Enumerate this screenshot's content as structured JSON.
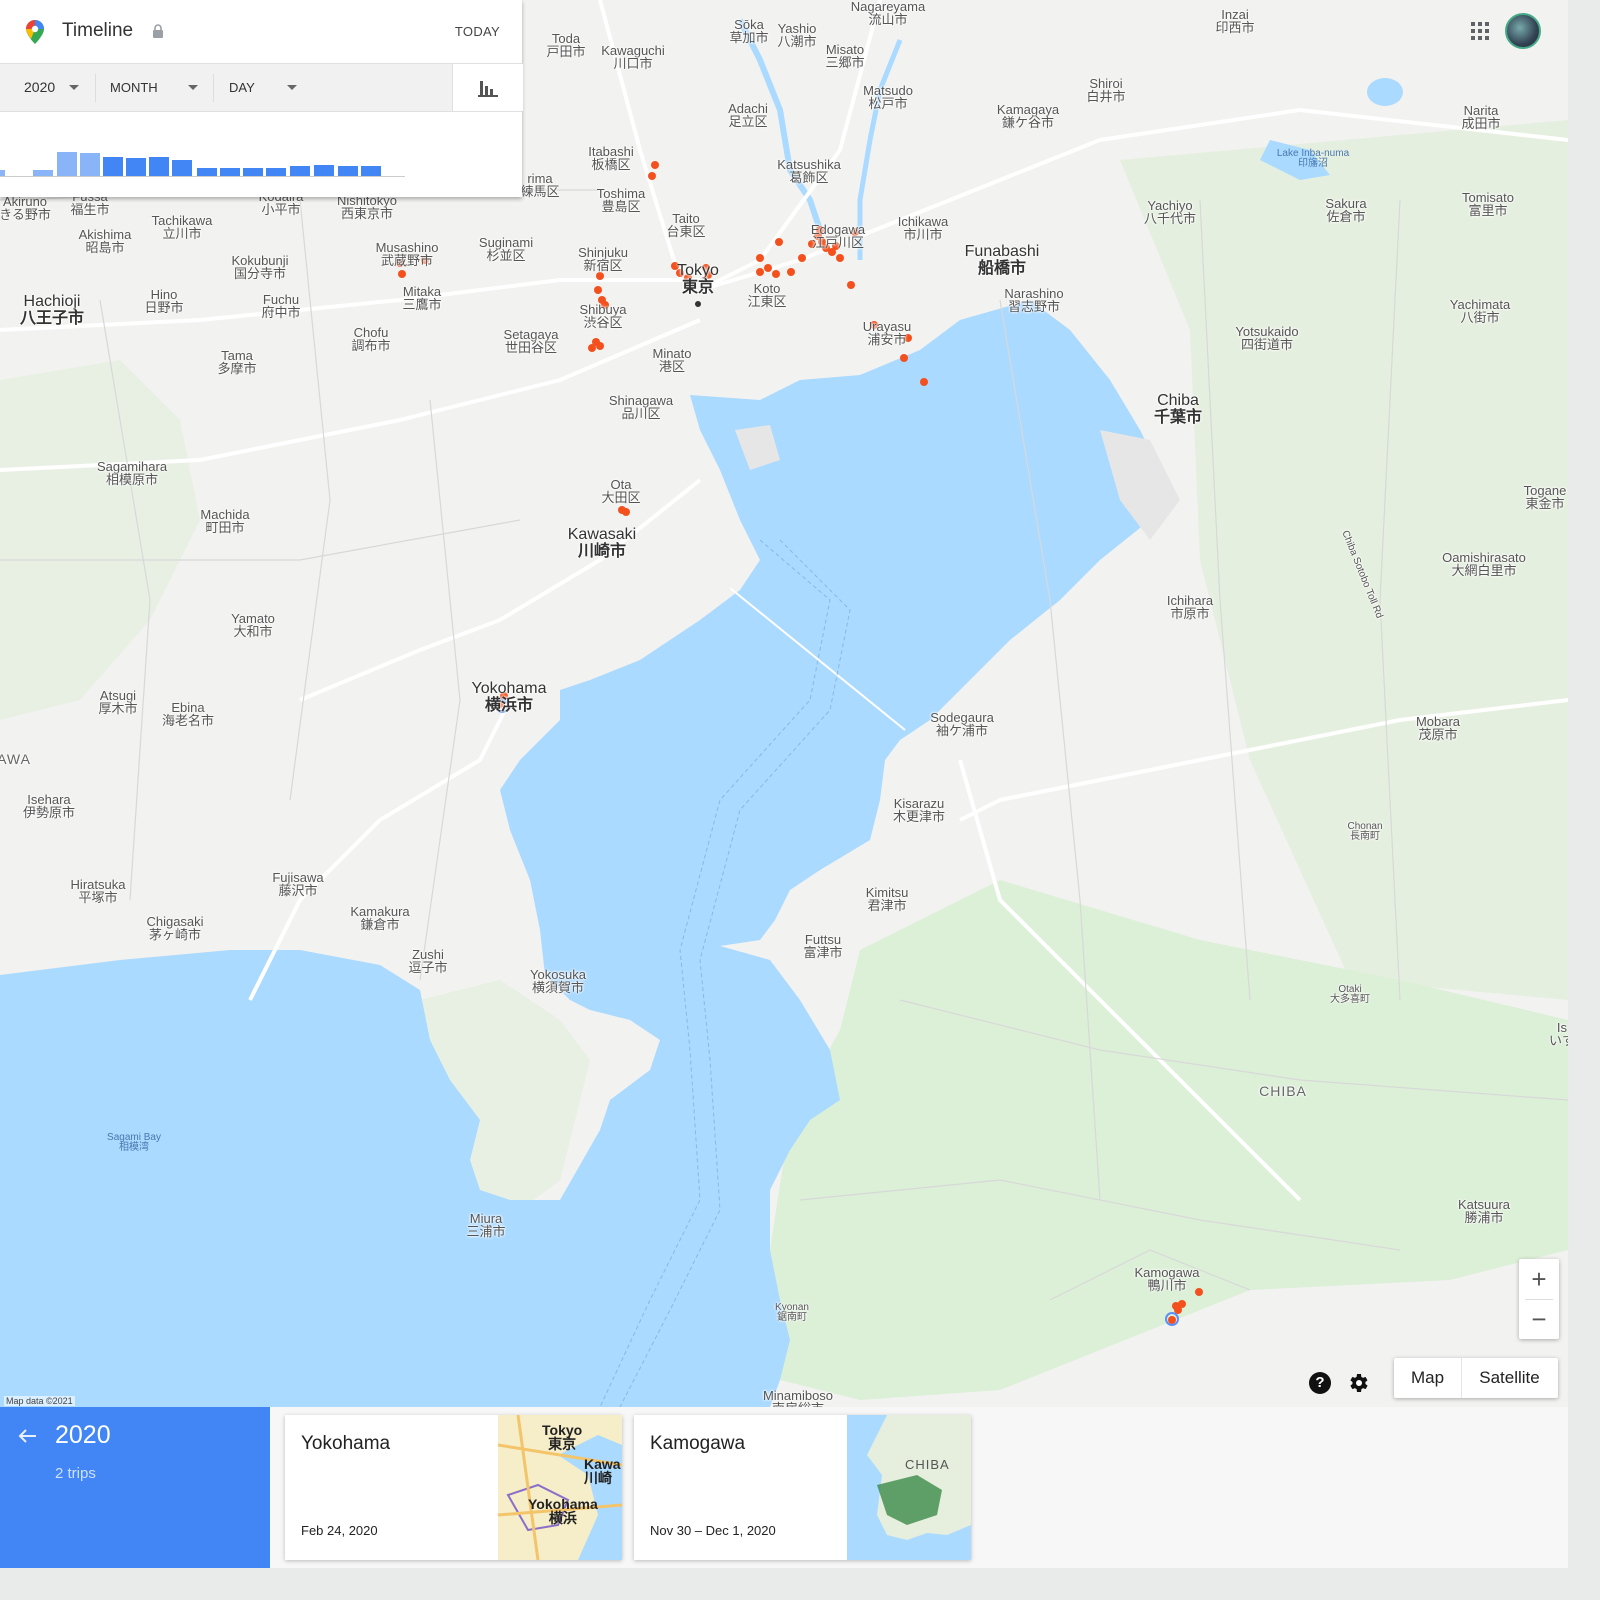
{
  "timeline": {
    "title": "Timeline",
    "today_label": "TODAY",
    "year_value": "2020",
    "month_label": "MONTH",
    "day_label": "DAY",
    "histogram": [
      0.25,
      0.25,
      1.0,
      0.95,
      0.8,
      0.75,
      0.8,
      0.65,
      0.35,
      0.35,
      0.35,
      0.35,
      0.4,
      0.45,
      0.4,
      0.4
    ],
    "colors": {
      "bar": "#4285f4",
      "bar_light": "#8ab4f8"
    }
  },
  "map": {
    "attribution": "Map data ©2021",
    "colors": {
      "water": "#aadaff",
      "land": "#f2f2f0",
      "green": "#dcefd7",
      "road": "#ffffff",
      "location_dot": "#f4501e",
      "route": "#5c8ff7"
    },
    "labels": [
      {
        "id": "nagareyama",
        "en": "Nagareyama",
        "jp": "流山市"
      },
      {
        "id": "inzai",
        "en": "Inzai",
        "jp": "印西市"
      },
      {
        "id": "soka",
        "en": "Sōka",
        "jp": "草加市"
      },
      {
        "id": "yashio",
        "en": "Yashio",
        "jp": "八潮市"
      },
      {
        "id": "misato",
        "en": "Misato",
        "jp": "三郷市"
      },
      {
        "id": "toda",
        "en": "Toda",
        "jp": "戸田市"
      },
      {
        "id": "kawaguchi",
        "en": "Kawaguchi",
        "jp": "川口市"
      },
      {
        "id": "shiroi",
        "en": "Shiroi",
        "jp": "白井市"
      },
      {
        "id": "matsudo",
        "en": "Matsudo",
        "jp": "松戸市"
      },
      {
        "id": "kamagaya",
        "en": "Kamagaya",
        "jp": "鎌ケ谷市"
      },
      {
        "id": "adachi",
        "en": "Adachi",
        "jp": "足立区"
      },
      {
        "id": "narita",
        "en": "Narita",
        "jp": "成田市"
      },
      {
        "id": "inba",
        "en": "Lake Inba-numa",
        "jp": "印旛沼"
      },
      {
        "id": "itabashi",
        "en": "Itabashi",
        "jp": "板橋区"
      },
      {
        "id": "katsushika",
        "en": "Katsushika",
        "jp": "葛飾区"
      },
      {
        "id": "nerima",
        "en": "rima",
        "jp": "練馬区"
      },
      {
        "id": "toshima",
        "en": "Toshima",
        "jp": "豊島区"
      },
      {
        "id": "fussa",
        "en": "Fussa",
        "jp": "福生市"
      },
      {
        "id": "akiruno",
        "en": "Akiruno",
        "jp": "きる野市"
      },
      {
        "id": "kodaira",
        "en": "Kodaira",
        "jp": "小平市"
      },
      {
        "id": "nishitokyo",
        "en": "Nishitokyo",
        "jp": "西東京市"
      },
      {
        "id": "taito",
        "en": "Taito",
        "jp": "台東区"
      },
      {
        "id": "edogawa",
        "en": "Edogawa",
        "jp": "江戸川区"
      },
      {
        "id": "ichikawa",
        "en": "Ichikawa",
        "jp": "市川市"
      },
      {
        "id": "yachiyo",
        "en": "Yachiyo",
        "jp": "八千代市"
      },
      {
        "id": "sakura",
        "en": "Sakura",
        "jp": "佐倉市"
      },
      {
        "id": "tomisato",
        "en": "Tomisato",
        "jp": "富里市"
      },
      {
        "id": "tachikawa",
        "en": "Tachikawa",
        "jp": "立川市"
      },
      {
        "id": "akishima",
        "en": "Akishima",
        "jp": "昭島市"
      },
      {
        "id": "suginami",
        "en": "Suginami",
        "jp": "杉並区"
      },
      {
        "id": "musashino",
        "en": "Musashino",
        "jp": "武蔵野市"
      },
      {
        "id": "shinjuku",
        "en": "Shinjuku",
        "jp": "新宿区"
      },
      {
        "id": "kokubunji",
        "en": "Kokubunji",
        "jp": "国分寺市"
      },
      {
        "id": "funabashi",
        "en": "Funabashi",
        "jp": "船橋市"
      },
      {
        "id": "tokyo",
        "en": "Tokyo",
        "jp": "東京"
      },
      {
        "id": "hachioji",
        "en": "Hachioji",
        "jp": "八王子市"
      },
      {
        "id": "hino",
        "en": "Hino",
        "jp": "日野市"
      },
      {
        "id": "fuchu",
        "en": "Fuchu",
        "jp": "府中市"
      },
      {
        "id": "mitaka",
        "en": "Mitaka",
        "jp": "三鷹市"
      },
      {
        "id": "koto",
        "en": "Koto",
        "jp": "江東区"
      },
      {
        "id": "narashino",
        "en": "Narashino",
        "jp": "習志野市"
      },
      {
        "id": "shibuya",
        "en": "Shibuya",
        "jp": "渋谷区"
      },
      {
        "id": "yachimata",
        "en": "Yachimata",
        "jp": "八街市"
      },
      {
        "id": "urayasu",
        "en": "Urayasu",
        "jp": "浦安市"
      },
      {
        "id": "chofu",
        "en": "Chofu",
        "jp": "調布市"
      },
      {
        "id": "setagaya",
        "en": "Setagaya",
        "jp": "世田谷区"
      },
      {
        "id": "yotsukaido",
        "en": "Yotsukaido",
        "jp": "四街道市"
      },
      {
        "id": "minato",
        "en": "Minato",
        "jp": "港区"
      },
      {
        "id": "tama",
        "en": "Tama",
        "jp": "多摩市"
      },
      {
        "id": "chiba",
        "en": "Chiba",
        "jp": "千葉市"
      },
      {
        "id": "shinagawa",
        "en": "Shinagawa",
        "jp": "品川区"
      },
      {
        "id": "sagamihara",
        "en": "Sagamihara",
        "jp": "相模原市"
      },
      {
        "id": "ota",
        "en": "Ota",
        "jp": "大田区"
      },
      {
        "id": "togane",
        "en": "Togane",
        "jp": "東金市"
      },
      {
        "id": "machida",
        "en": "Machida",
        "jp": "町田市"
      },
      {
        "id": "kawasaki",
        "en": "Kawasaki",
        "jp": "川崎市"
      },
      {
        "id": "oamishirasato",
        "en": "Oamishirasato",
        "jp": "大網白里市"
      },
      {
        "id": "chiba_toll",
        "en": "Chiba Sotobo Toll Rd",
        "jp": ""
      },
      {
        "id": "ichihara",
        "en": "Ichihara",
        "jp": "市原市"
      },
      {
        "id": "yamato",
        "en": "Yamato",
        "jp": "大和市"
      },
      {
        "id": "yokohama",
        "en": "Yokohama",
        "jp": "横浜市"
      },
      {
        "id": "atsugi",
        "en": "Atsugi",
        "jp": "厚木市"
      },
      {
        "id": "ebina",
        "en": "Ebina",
        "jp": "海老名市"
      },
      {
        "id": "sodegaura",
        "en": "Sodegaura",
        "jp": "袖ケ浦市"
      },
      {
        "id": "mobara",
        "en": "Mobara",
        "jp": "茂原市"
      },
      {
        "id": "kanagawa",
        "en": "AWA",
        "jp": ""
      },
      {
        "id": "isehara",
        "en": "Isehara",
        "jp": "伊勢原市"
      },
      {
        "id": "kisarazu",
        "en": "Kisarazu",
        "jp": "木更津市"
      },
      {
        "id": "chonan",
        "en": "Chonan",
        "jp": "長南町"
      },
      {
        "id": "hiratsuka",
        "en": "Hiratsuka",
        "jp": "平塚市"
      },
      {
        "id": "fujisawa",
        "en": "Fujisawa",
        "jp": "藤沢市"
      },
      {
        "id": "kimitsu",
        "en": "Kimitsu",
        "jp": "君津市"
      },
      {
        "id": "kamakura",
        "en": "Kamakura",
        "jp": "鎌倉市"
      },
      {
        "id": "chigasaki",
        "en": "Chigasaki",
        "jp": "茅ヶ崎市"
      },
      {
        "id": "futtsu",
        "en": "Futtsu",
        "jp": "富津市"
      },
      {
        "id": "zushi",
        "en": "Zushi",
        "jp": "逗子市"
      },
      {
        "id": "yokosuka",
        "en": "Yokosuka",
        "jp": "横須賀市"
      },
      {
        "id": "otaki",
        "en": "Otaki",
        "jp": "大多喜町"
      },
      {
        "id": "isumi",
        "en": "Is",
        "jp": "いす"
      },
      {
        "id": "chiba_pref",
        "en": "CHIBA",
        "jp": ""
      },
      {
        "id": "sagami_bay",
        "en": "Sagami Bay",
        "jp": "相模湾"
      },
      {
        "id": "katsuura",
        "en": "Katsuura",
        "jp": "勝浦市"
      },
      {
        "id": "miura",
        "en": "Miura",
        "jp": "三浦市"
      },
      {
        "id": "kamogawa",
        "en": "Kamogawa",
        "jp": "鴨川市"
      },
      {
        "id": "kyonan",
        "en": "Kyonan",
        "jp": "鋸南町"
      },
      {
        "id": "minamiboso",
        "en": "Minamiboso",
        "jp": "南房総市"
      }
    ]
  },
  "controls": {
    "zoom_in": "+",
    "zoom_out": "−",
    "help": "?",
    "map_label": "Map",
    "satellite_label": "Satellite"
  },
  "bottom": {
    "year": "2020",
    "trips_count": "2 trips",
    "trips": [
      {
        "name": "Yokohama",
        "date": "Feb 24, 2020",
        "thumb_labels": [
          "Tokyo",
          "東京",
          "Kawa",
          "川崎",
          "Yokohama",
          "横浜"
        ]
      },
      {
        "name": "Kamogawa",
        "date": "Nov 30 – Dec 1, 2020",
        "thumb_labels": [
          "CHIBA"
        ]
      }
    ]
  }
}
